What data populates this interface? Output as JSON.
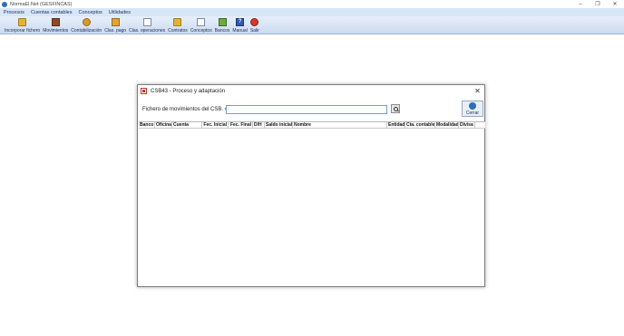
{
  "window": {
    "title": "NormaEl.Net (GESFINCAS)",
    "controls": {
      "minimize": "–",
      "restore": "❐",
      "close": "✕"
    }
  },
  "menu": {
    "items": [
      "Procesos",
      "Cuentas contables",
      "Conceptos",
      "Utilidades"
    ]
  },
  "toolbar": {
    "items": [
      {
        "label": "Incorporar fichero",
        "icon": "folder-icon"
      },
      {
        "label": "Movimientos",
        "icon": "ledger-icon"
      },
      {
        "label": "Contabilización",
        "icon": "coins-icon"
      },
      {
        "label": "Clas. pago",
        "icon": "document-icon"
      },
      {
        "label": "Clas. operaciones",
        "icon": "document-icon"
      },
      {
        "label": "Contratos",
        "icon": "book-icon"
      },
      {
        "label": "Conceptos",
        "icon": "checklist-icon"
      },
      {
        "label": "Bancos",
        "icon": "bank-icon"
      },
      {
        "label": "Manual",
        "icon": "help-icon"
      },
      {
        "label": "Salir",
        "icon": "exit-icon"
      }
    ]
  },
  "dialog": {
    "title": "CSB43 - Proceso y adaptación",
    "close_glyph": "✕",
    "file_label": "Fichero de movimientos del CSB. 43:",
    "file_value": "",
    "close_button_label": "Cerrar",
    "columns": [
      "Banco",
      "Oficina",
      "Cuenta",
      "Fec. Inicial",
      "Fec. Final",
      "D/H",
      "Saldo inicial",
      "Nombre",
      "Entidad",
      "Cta. contable",
      "Modalidad",
      "Divisa"
    ],
    "rows": []
  }
}
